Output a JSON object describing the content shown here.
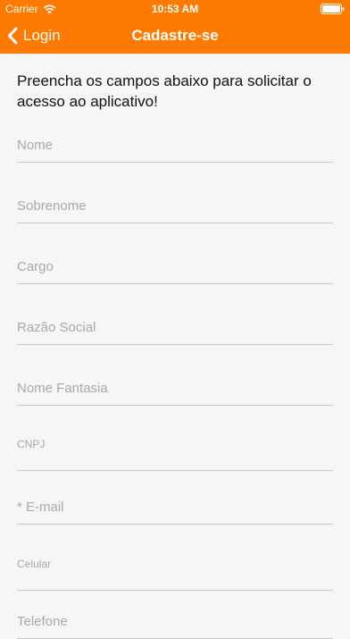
{
  "status_bar": {
    "carrier": "Carrier",
    "time": "10:53 AM"
  },
  "navbar": {
    "back_label": "Login",
    "title": "Cadastre-se",
    "bar_color": "#ff7a00"
  },
  "form": {
    "intro": "Preencha os campos abaixo para solicitar o acesso ao aplicativo!",
    "fields": [
      {
        "placeholder": "Nome",
        "value": ""
      },
      {
        "placeholder": "Sobrenome",
        "value": ""
      },
      {
        "placeholder": "Cargo",
        "value": ""
      },
      {
        "placeholder": "Razão Social",
        "value": ""
      },
      {
        "placeholder": "Nome Fantasia",
        "value": ""
      },
      {
        "placeholder": "CNPJ",
        "value": ""
      },
      {
        "placeholder": "* E-mail",
        "value": ""
      },
      {
        "placeholder": "Celular",
        "value": ""
      },
      {
        "placeholder": "Telefone",
        "value": ""
      }
    ]
  }
}
